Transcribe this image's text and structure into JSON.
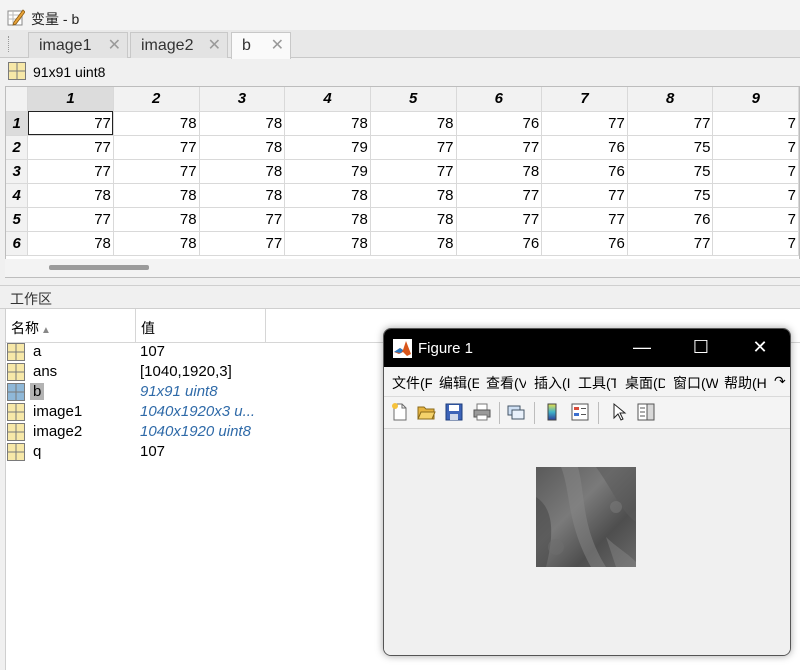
{
  "variable_editor": {
    "title": "变量 - b",
    "tabs": [
      {
        "label": "image1",
        "close": "✕"
      },
      {
        "label": "image2",
        "close": "✕"
      },
      {
        "label": "b",
        "close": "✕"
      }
    ],
    "info": "91x91 uint8",
    "col_headers": [
      "1",
      "2",
      "3",
      "4",
      "5",
      "6",
      "7",
      "8",
      "9"
    ],
    "rows": [
      {
        "h": "1",
        "v": [
          "77",
          "78",
          "78",
          "78",
          "78",
          "76",
          "77",
          "77",
          "7"
        ]
      },
      {
        "h": "2",
        "v": [
          "77",
          "77",
          "78",
          "79",
          "77",
          "77",
          "76",
          "75",
          "7"
        ]
      },
      {
        "h": "3",
        "v": [
          "77",
          "77",
          "78",
          "79",
          "77",
          "78",
          "76",
          "75",
          "7"
        ]
      },
      {
        "h": "4",
        "v": [
          "78",
          "78",
          "78",
          "78",
          "78",
          "77",
          "77",
          "75",
          "7"
        ]
      },
      {
        "h": "5",
        "v": [
          "77",
          "78",
          "77",
          "78",
          "78",
          "77",
          "77",
          "76",
          "7"
        ]
      },
      {
        "h": "6",
        "v": [
          "78",
          "78",
          "77",
          "78",
          "78",
          "76",
          "76",
          "77",
          "7"
        ]
      }
    ]
  },
  "workspace": {
    "title": "工作区",
    "col_name": "名称",
    "sort_arrow": "▲",
    "col_value": "值",
    "vars": [
      {
        "name": "a",
        "value": "107",
        "italic": false
      },
      {
        "name": "ans",
        "value": "[1040,1920,3]",
        "italic": false
      },
      {
        "name": "b",
        "value": "91x91 uint8",
        "italic": true
      },
      {
        "name": "image1",
        "value": "1040x1920x3 u...",
        "italic": true
      },
      {
        "name": "image2",
        "value": "1040x1920 uint8",
        "italic": true
      },
      {
        "name": "q",
        "value": "107",
        "italic": false
      }
    ]
  },
  "figure": {
    "title": "Figure 1",
    "min": "—",
    "max": "☐",
    "close": "✕",
    "menu": [
      "文件(F",
      "编辑(E",
      "查看(V",
      "插入(I",
      "工具(T",
      "桌面(D",
      "窗口(W",
      "帮助(H"
    ],
    "menu_more": "↷",
    "toolbar": [
      "new-file-icon",
      "open-folder-icon",
      "save-icon",
      "print-icon",
      "link-figure-icon",
      "colorbar-icon",
      "legend-icon",
      "pointer-icon",
      "property-editor-icon"
    ]
  }
}
